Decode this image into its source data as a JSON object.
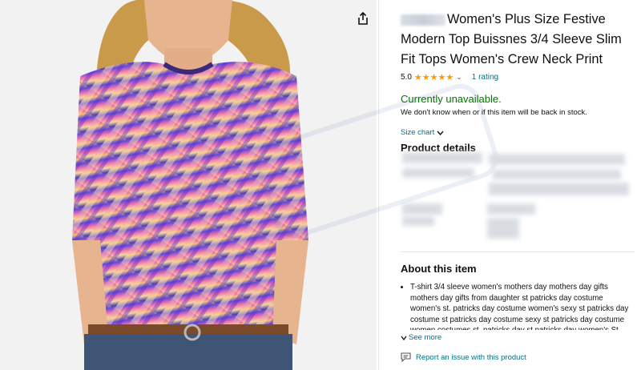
{
  "product": {
    "title": "Women's Plus Size Festive Modern Top Buissnes 3/4 Sleeve Slim Fit Tops Women's Crew Neck Print",
    "rating_value": "5.0",
    "rating_stars": 5,
    "rating_count": "1 rating",
    "availability": "Currently unavailable.",
    "availability_note": "We don't know when or if this item will be back in stock.",
    "size_chart_label": "Size chart"
  },
  "sections": {
    "product_details_heading": "Product details",
    "about_heading": "About this item",
    "about_bullet": "T-shirt 3/4 sleeve women's mothers day mothers day gifts mothers day gifts from daughter st patricks day costume women's st. patricks day costume women's sexy st patricks day costume st patricks day costume sexy st patricks day costume women costumes st. patricks day st patricks day women's St",
    "see_more": "See more",
    "report_issue": "Report an issue with this product"
  },
  "icons": {
    "share": "share-icon",
    "chevron": "chevron-down-icon",
    "report": "feedback-icon"
  },
  "colors": {
    "link": "#007185",
    "available": "#007600",
    "star": "#ff9900"
  }
}
